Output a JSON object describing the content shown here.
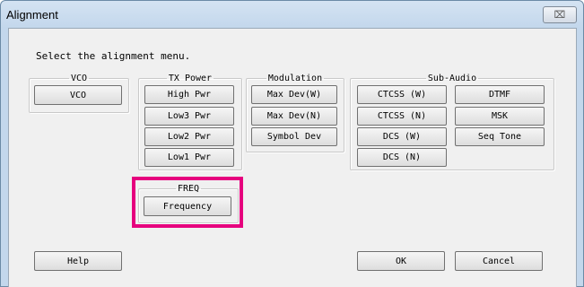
{
  "window": {
    "title": "Alignment",
    "close_glyph": "⌧"
  },
  "prompt": "Select the alignment menu.",
  "groups": {
    "vco": {
      "legend": "VCO",
      "buttons": [
        "VCO"
      ]
    },
    "tx_power": {
      "legend": "TX Power",
      "buttons": [
        "High Pwr",
        "Low3 Pwr",
        "Low2 Pwr",
        "Low1 Pwr"
      ]
    },
    "modulation": {
      "legend": "Modulation",
      "buttons": [
        "Max Dev(W)",
        "Max Dev(N)",
        "Symbol Dev"
      ]
    },
    "sub_audio": {
      "legend": "Sub-Audio",
      "buttons": [
        "CTCSS (W)",
        "CTCSS (N)",
        "DCS (W)",
        "DCS (N)",
        "DTMF",
        "MSK",
        "Seq Tone"
      ]
    },
    "freq": {
      "legend": "FREQ",
      "buttons": [
        "Frequency"
      ]
    }
  },
  "footer": {
    "help": "Help",
    "ok": "OK",
    "cancel": "Cancel"
  },
  "colors": {
    "highlight": "#e6007e",
    "titlebar": "#c3d7ec"
  }
}
